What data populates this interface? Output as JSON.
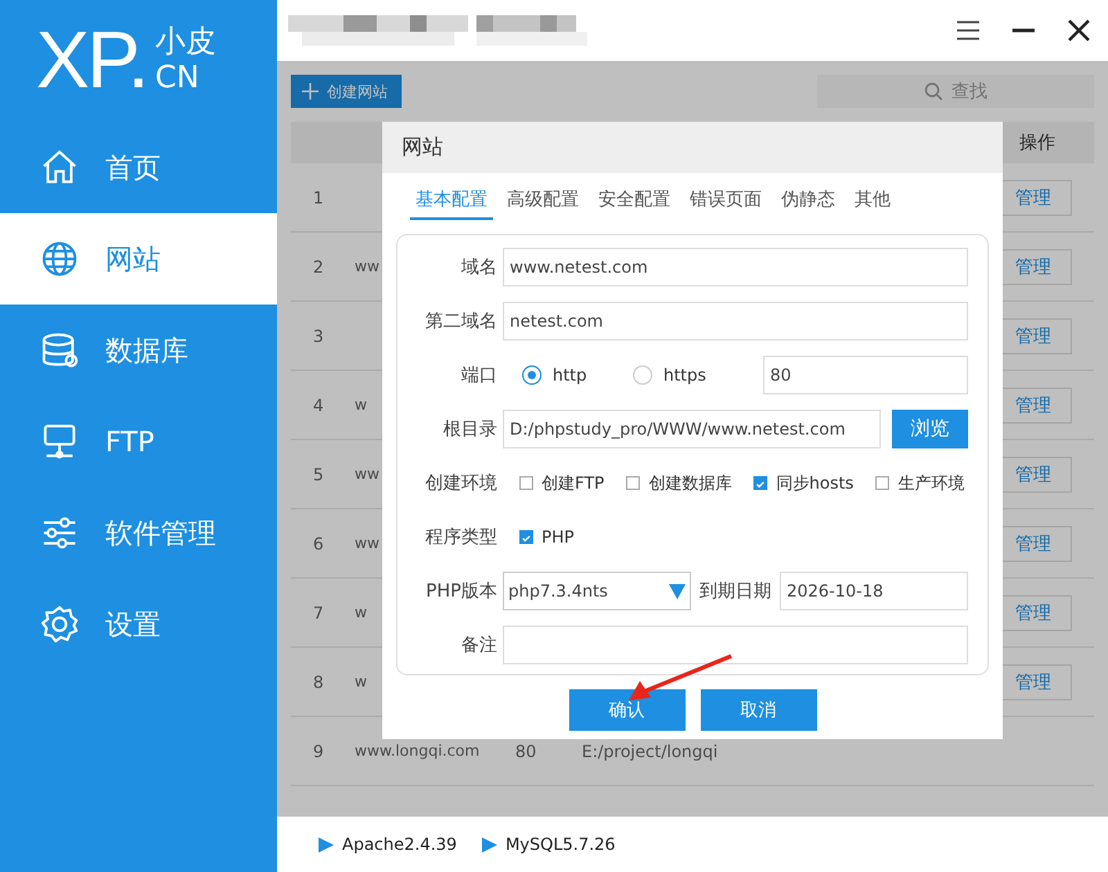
{
  "sidebar": {
    "logo": {
      "mark": "XP.",
      "top": "小皮",
      "bottom": "CN"
    },
    "items": [
      {
        "label": "首页",
        "selected": false
      },
      {
        "label": "网站",
        "selected": true
      },
      {
        "label": "数据库",
        "selected": false
      },
      {
        "label": "FTP",
        "selected": false
      },
      {
        "label": "软件管理",
        "selected": false
      },
      {
        "label": "设置",
        "selected": false
      }
    ]
  },
  "toolbar": {
    "create_button": "创建网站",
    "search": {
      "placeholder": "查找"
    }
  },
  "table": {
    "columns": {
      "action": "操作"
    },
    "rows": [
      {
        "column_1": "1",
        "action": "管理"
      },
      {
        "column_1": "2",
        "column_2": "ww",
        "action": "管理"
      },
      {
        "column_1": "3",
        "action": "管理"
      },
      {
        "column_1": "4",
        "column_2": "w",
        "action": "管理"
      },
      {
        "column_1": "5",
        "column_2": "ww",
        "action": "管理"
      },
      {
        "column_1": "6",
        "column_2": "ww",
        "action": "管理"
      },
      {
        "column_1": "7",
        "column_2": "w",
        "action": "管理"
      },
      {
        "column_1": "8",
        "column_2": "w",
        "action": "管理"
      },
      {
        "column_1": "9",
        "column_2": "www.longqi.com",
        "column_3": "80",
        "column_4": "E:/project/longqi"
      }
    ]
  },
  "dialog": {
    "title": "网站",
    "tabs": [
      {
        "label": "基本配置",
        "selected": true
      },
      {
        "label": "高级配置",
        "selected": false
      },
      {
        "label": "安全配置",
        "selected": false
      },
      {
        "label": "错误页面",
        "selected": false
      },
      {
        "label": "伪静态",
        "selected": false
      },
      {
        "label": "其他",
        "selected": false
      }
    ],
    "fields": [
      {
        "kind": "text",
        "label": "域名",
        "value": "www.netest.com"
      },
      {
        "kind": "text",
        "label": "第二域名",
        "value": "netest.com"
      },
      {
        "kind": "port",
        "label": "端口",
        "options": [
          {
            "label": "http",
            "selected": true
          },
          {
            "label": "https",
            "selected": false
          }
        ],
        "value": "80"
      },
      {
        "kind": "path",
        "label": "根目录",
        "value": "D:/phpstudy_pro/WWW/www.netest.com",
        "button": "浏览"
      },
      {
        "kind": "checks",
        "label": "创建环境",
        "options": [
          {
            "label": "创建FTP",
            "checked": false
          },
          {
            "label": "创建数据库",
            "checked": false
          },
          {
            "label": "同步hosts",
            "checked": true
          },
          {
            "label": "生产环境",
            "checked": false
          }
        ]
      },
      {
        "kind": "checks",
        "label": "程序类型",
        "options": [
          {
            "label": "PHP",
            "checked": true
          }
        ]
      },
      {
        "kind": "select_date",
        "label": "PHP版本",
        "value": "php7.3.4nts",
        "date_label": "到期日期",
        "date_value": "2026-10-18"
      },
      {
        "kind": "text",
        "label": "备注"
      }
    ],
    "buttons": [
      "确认",
      "取消"
    ]
  },
  "status_bar": {
    "services": [
      "Apache2.4.39",
      "MySQL5.7.26"
    ]
  }
}
